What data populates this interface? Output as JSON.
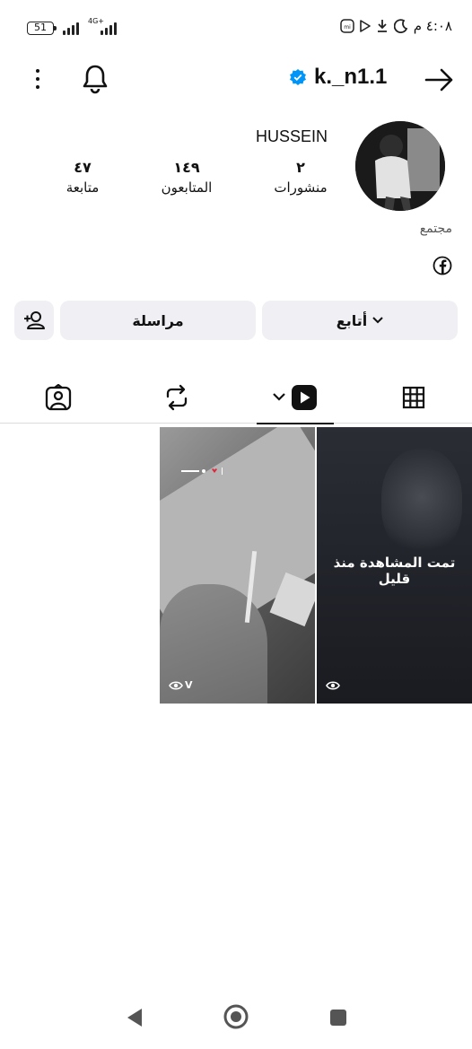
{
  "status_bar": {
    "battery": "51",
    "network": "4G+",
    "time": "٤:٠٨ م",
    "icons": [
      "moon-icon",
      "download-icon",
      "play-store-icon",
      "mi-icon",
      "signal-icon",
      "battery-icon"
    ]
  },
  "header": {
    "username": "k._n1.1",
    "verified": true,
    "icons": [
      "back-arrow-icon",
      "verified-badge-icon",
      "bell-icon",
      "more-icon"
    ]
  },
  "profile": {
    "display_name": "HUSSEIN",
    "category": "مجتمع",
    "stats": {
      "posts": {
        "value": "٢",
        "label": "منشورات"
      },
      "followers": {
        "value": "١٤٩",
        "label": "المتابعون"
      },
      "following": {
        "value": "٤٧",
        "label": "متابعة"
      }
    },
    "links": [
      "facebook-icon"
    ]
  },
  "actions": {
    "follow_label": "أتابع",
    "message_label": "مراسلة",
    "suggest_icon": "add-person-icon"
  },
  "tabs": [
    {
      "name": "grid",
      "icon": "grid-icon"
    },
    {
      "name": "reels",
      "icon": "reels-icon",
      "active": true
    },
    {
      "name": "reposts",
      "icon": "repost-icon"
    },
    {
      "name": "tagged",
      "icon": "tagged-person-icon"
    }
  ],
  "reels": [
    {
      "overlay": "تمت المشاهدة منذ قليل",
      "views": ""
    },
    {
      "overlay": "",
      "views": "V"
    }
  ],
  "colors": {
    "verified_blue": "#0095f6",
    "button_bg": "#efeff4",
    "text": "#111111"
  }
}
